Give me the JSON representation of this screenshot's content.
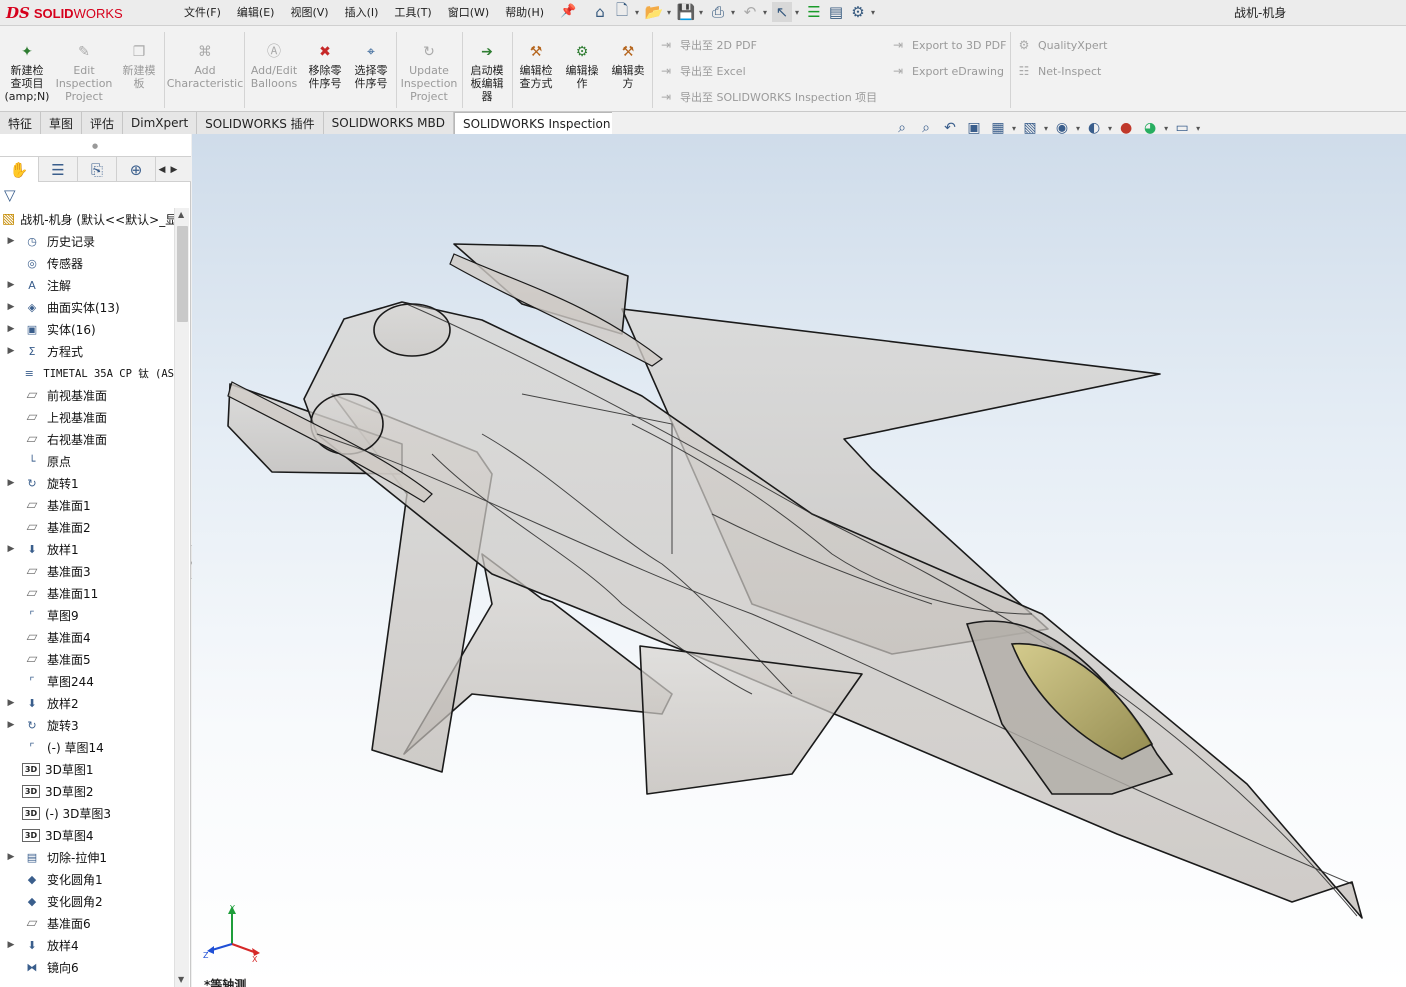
{
  "app": {
    "logo_ds": "DS",
    "logo_text_bold": "SOLID",
    "logo_text": "WORKS",
    "document_title": "战机-机身"
  },
  "menu": [
    "文件(F)",
    "编辑(E)",
    "视图(V)",
    "插入(I)",
    "工具(T)",
    "窗口(W)",
    "帮助(H)"
  ],
  "ribbon": {
    "buttons": [
      {
        "label": "新建检查项目(amp;N)",
        "lines": [
          "新建检",
          "查项目",
          "(amp;N)"
        ],
        "enabled": true
      },
      {
        "label": "Edit Inspection Project",
        "lines": [
          "Edit",
          "Inspection",
          "Project"
        ],
        "enabled": false
      },
      {
        "label": "新建模板",
        "lines": [
          "新建模",
          "板"
        ],
        "enabled": false
      },
      {
        "label": "Add Characteristic",
        "lines": [
          "Add",
          "Characteristic"
        ],
        "enabled": false
      },
      {
        "label": "Add/Edit Balloons",
        "lines": [
          "Add/Edit",
          "Balloons"
        ],
        "enabled": false
      },
      {
        "label": "移除零件序号",
        "lines": [
          "移除零",
          "件序号"
        ],
        "enabled": true
      },
      {
        "label": "选择零件序号",
        "lines": [
          "选择零",
          "件序号"
        ],
        "enabled": true
      },
      {
        "label": "Update Inspection Project",
        "lines": [
          "Update",
          "Inspection",
          "Project"
        ],
        "enabled": false
      },
      {
        "label": "启动模板编辑器",
        "lines": [
          "启动模",
          "板编辑",
          "器"
        ],
        "enabled": true
      },
      {
        "label": "编辑检查方式",
        "lines": [
          "编辑检",
          "查方式"
        ],
        "enabled": true
      },
      {
        "label": "编辑操作",
        "lines": [
          "编辑操",
          "作"
        ],
        "enabled": true
      },
      {
        "label": "编辑卖方",
        "lines": [
          "编辑卖",
          "方"
        ],
        "enabled": true
      }
    ],
    "export_col1": [
      "导出至 2D PDF",
      "导出至 Excel",
      "导出至 SOLIDWORKS Inspection 项目"
    ],
    "export_col2": [
      "Export to 3D PDF",
      "Export eDrawing"
    ],
    "export_col3": [
      "QualityXpert",
      "Net-Inspect"
    ]
  },
  "tabs": [
    {
      "label": "特征",
      "active": false
    },
    {
      "label": "草图",
      "active": false
    },
    {
      "label": "评估",
      "active": false
    },
    {
      "label": "DimXpert",
      "active": false
    },
    {
      "label": "SOLIDWORKS 插件",
      "active": false
    },
    {
      "label": "SOLIDWORKS MBD",
      "active": false
    },
    {
      "label": "SOLIDWORKS Inspection",
      "active": true
    }
  ],
  "feature_tree": {
    "root": "战机-机身  (默认<<默认>_显",
    "items": [
      {
        "label": "历史记录",
        "icon": "history-icon",
        "expand": true
      },
      {
        "label": "传感器",
        "icon": "sensor-icon",
        "expand": false
      },
      {
        "label": "注解",
        "icon": "annotation-icon",
        "expand": true
      },
      {
        "label": "曲面实体(13)",
        "icon": "surface-body-icon",
        "expand": true
      },
      {
        "label": "实体(16)",
        "icon": "solid-body-icon",
        "expand": true
      },
      {
        "label": "方程式",
        "icon": "equation-icon",
        "expand": true
      },
      {
        "label": "TIMETAL 35A CP 钛 (AS",
        "icon": "material-icon",
        "expand": false
      },
      {
        "label": "前视基准面",
        "icon": "plane-icon",
        "expand": false
      },
      {
        "label": "上视基准面",
        "icon": "plane-icon",
        "expand": false
      },
      {
        "label": "右视基准面",
        "icon": "plane-icon",
        "expand": false
      },
      {
        "label": "原点",
        "icon": "origin-icon",
        "expand": false
      },
      {
        "label": "旋转1",
        "icon": "revolve-icon",
        "expand": true
      },
      {
        "label": "基准面1",
        "icon": "plane-icon",
        "expand": false
      },
      {
        "label": "基准面2",
        "icon": "plane-icon",
        "expand": false
      },
      {
        "label": "放样1",
        "icon": "loft-icon",
        "expand": true
      },
      {
        "label": "基准面3",
        "icon": "plane-icon",
        "expand": false
      },
      {
        "label": "基准面11",
        "icon": "plane-icon",
        "expand": false
      },
      {
        "label": "草图9",
        "icon": "sketch-icon",
        "expand": false
      },
      {
        "label": "基准面4",
        "icon": "plane-icon",
        "expand": false
      },
      {
        "label": "基准面5",
        "icon": "plane-icon",
        "expand": false
      },
      {
        "label": "草图244",
        "icon": "sketch-icon",
        "expand": false
      },
      {
        "label": "放样2",
        "icon": "loft-icon",
        "expand": true
      },
      {
        "label": "旋转3",
        "icon": "revolve-icon",
        "expand": true
      },
      {
        "label": "(-) 草图14",
        "icon": "sketch-icon",
        "expand": false
      },
      {
        "label": "3D草图1",
        "icon": "sketch3d-icon",
        "expand": false
      },
      {
        "label": "3D草图2",
        "icon": "sketch3d-icon",
        "expand": false
      },
      {
        "label": "(-) 3D草图3",
        "icon": "sketch3d-icon",
        "expand": false
      },
      {
        "label": "3D草图4",
        "icon": "sketch3d-icon",
        "expand": false
      },
      {
        "label": "切除-拉伸1",
        "icon": "cut-extrude-icon",
        "expand": true
      },
      {
        "label": "变化圆角1",
        "icon": "fillet-icon",
        "expand": false
      },
      {
        "label": "变化圆角2",
        "icon": "fillet-icon",
        "expand": false
      },
      {
        "label": "基准面6",
        "icon": "plane-icon",
        "expand": false
      },
      {
        "label": "放样4",
        "icon": "loft-icon",
        "expand": true
      },
      {
        "label": "镜向6",
        "icon": "mirror-icon",
        "expand": false
      }
    ]
  },
  "viewport": {
    "view_label": "*等轴测",
    "axis_x": "X",
    "axis_y": "Y",
    "axis_z": "Z"
  }
}
